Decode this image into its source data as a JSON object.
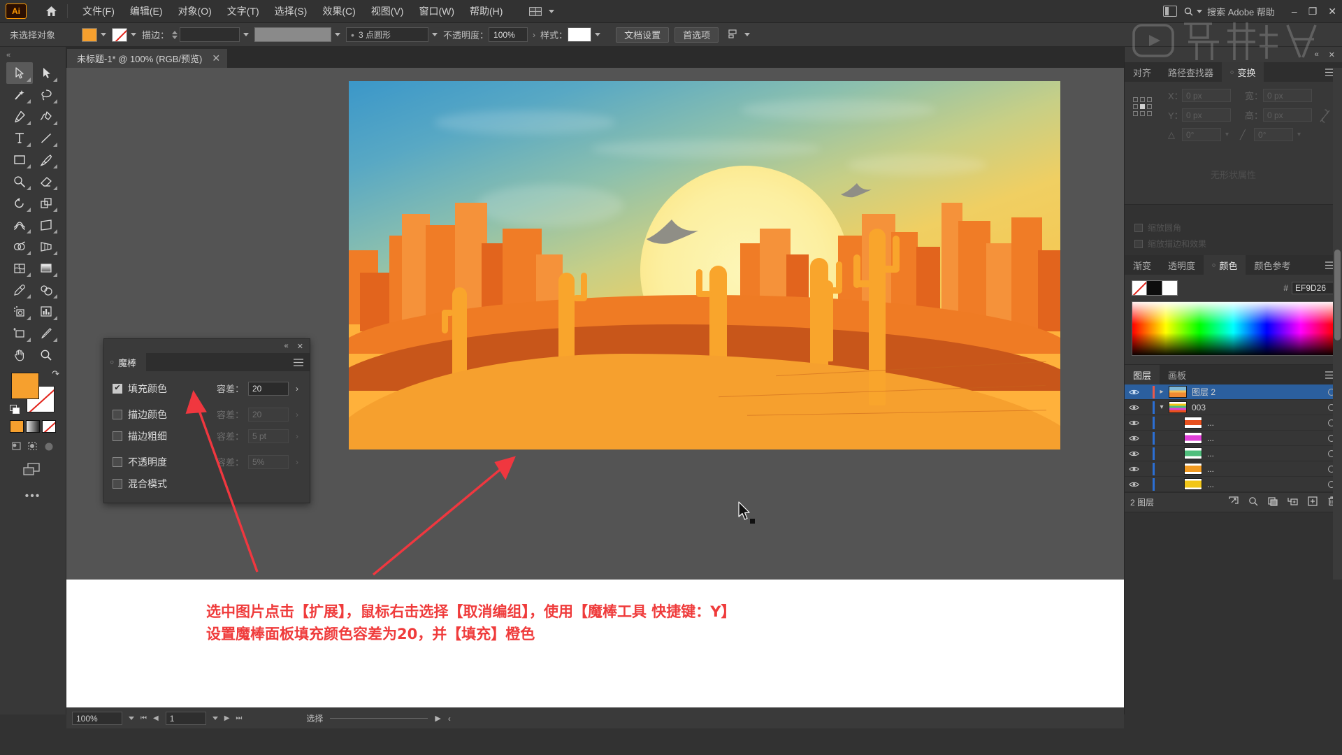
{
  "app": {
    "logo": "Ai",
    "home_icon": "home-icon",
    "search_placeholder": "搜索 Adobe 帮助",
    "window_minimize": "–",
    "window_maximize": "❐",
    "window_close": "✕"
  },
  "menu": {
    "items": [
      {
        "label": "文件(F)"
      },
      {
        "label": "编辑(E)"
      },
      {
        "label": "对象(O)"
      },
      {
        "label": "文字(T)"
      },
      {
        "label": "选择(S)"
      },
      {
        "label": "效果(C)"
      },
      {
        "label": "视图(V)"
      },
      {
        "label": "窗口(W)"
      },
      {
        "label": "帮助(H)"
      }
    ]
  },
  "control_bar": {
    "selection_status": "未选择对象",
    "fill_color": "#F6A02E",
    "stroke_label": "描边：",
    "stroke_weight": "",
    "stroke_profile": "",
    "brush_definition": "",
    "variable_width": "3 点圆形",
    "opacity_label": "不透明度：",
    "opacity_value": "100%",
    "style_label": "样式：",
    "doc_setup_button": "文档设置",
    "preferences_button": "首选项",
    "align_icon": "align-objects-icon"
  },
  "document_tab": {
    "title": "未标题-1* @ 100% (RGB/预览)",
    "close": "✕"
  },
  "toolbar": {
    "collapse": "«",
    "tools": [
      {
        "name": "selection-tool",
        "active": true
      },
      {
        "name": "direct-selection-tool",
        "active": false
      },
      {
        "name": "magic-wand-tool",
        "active": false
      },
      {
        "name": "lasso-tool",
        "active": false
      },
      {
        "name": "pen-tool",
        "active": false
      },
      {
        "name": "curvature-tool",
        "active": false
      },
      {
        "name": "type-tool",
        "active": false
      },
      {
        "name": "line-segment-tool",
        "active": false
      },
      {
        "name": "rectangle-tool",
        "active": false
      },
      {
        "name": "paintbrush-tool",
        "active": false
      },
      {
        "name": "shaper-tool",
        "active": false
      },
      {
        "name": "eraser-tool",
        "active": false
      },
      {
        "name": "rotate-tool",
        "active": false
      },
      {
        "name": "scale-tool",
        "active": false
      },
      {
        "name": "width-tool",
        "active": false
      },
      {
        "name": "free-transform-tool",
        "active": false
      },
      {
        "name": "shape-builder-tool",
        "active": false
      },
      {
        "name": "perspective-grid-tool",
        "active": false
      },
      {
        "name": "mesh-tool",
        "active": false
      },
      {
        "name": "gradient-tool",
        "active": false
      },
      {
        "name": "eyedropper-tool",
        "active": false
      },
      {
        "name": "blend-tool",
        "active": false
      },
      {
        "name": "symbol-sprayer-tool",
        "active": false
      },
      {
        "name": "column-graph-tool",
        "active": false
      },
      {
        "name": "artboard-tool",
        "active": false
      },
      {
        "name": "slice-tool",
        "active": false
      },
      {
        "name": "hand-tool",
        "active": false
      },
      {
        "name": "zoom-tool",
        "active": false
      }
    ],
    "fill_swatch": "#F6A02E",
    "stroke_swatch": "none",
    "more_tools": "•••"
  },
  "magic_wand_panel": {
    "title": "魔棒",
    "collapse_icon": "«",
    "close_icon": "✕",
    "menu_icon": "panel-menu-icon",
    "rows": [
      {
        "label": "填充颜色",
        "checked": true,
        "tol_label": "容差：",
        "tol_value": "20",
        "enabled": true
      },
      {
        "label": "描边颜色",
        "checked": false,
        "tol_label": "容差：",
        "tol_value": "20",
        "enabled": false
      },
      {
        "label": "描边粗细",
        "checked": false,
        "tol_label": "容差：",
        "tol_value": "5 pt",
        "enabled": false
      },
      {
        "label": "不透明度",
        "checked": false,
        "tol_label": "容差：",
        "tol_value": "5%",
        "enabled": false
      },
      {
        "label": "混合模式",
        "checked": false,
        "tol_label": "",
        "tol_value": "",
        "enabled": false
      }
    ]
  },
  "transform_panel": {
    "tabs": [
      {
        "label": "对齐",
        "active": false
      },
      {
        "label": "路径查找器",
        "active": false
      },
      {
        "label": "变换",
        "active": true
      }
    ],
    "x_label": "X：",
    "x_value": "0 px",
    "y_label": "Y：",
    "y_value": "0 px",
    "w_label": "宽：",
    "w_value": "0 px",
    "h_label": "高：",
    "h_value": "0 px",
    "angle_value": "0°",
    "shear_value": "0°",
    "link_icon": "link-broken-icon",
    "empty_note": "无形状属性",
    "scale_strokes_label": "缩放描边和效果",
    "scale_corners_label": "缩放圆角"
  },
  "color_panel": {
    "tabs": [
      {
        "label": "渐变",
        "active": false
      },
      {
        "label": "透明度",
        "active": false
      },
      {
        "label": "颜色",
        "active": true
      },
      {
        "label": "颜色参考",
        "active": false
      }
    ],
    "hex_hash": "#",
    "hex_value": "EF9D26",
    "swatch_none": "none-swatch",
    "swatch_black": "#0D0D0D",
    "swatch_white": "#FFFFFF"
  },
  "layers_panel": {
    "tabs": [
      {
        "label": "图层",
        "active": true
      },
      {
        "label": "画板",
        "active": false
      }
    ],
    "rows": [
      {
        "name": "图层 2",
        "selected": true,
        "indent": 0,
        "expanded": false,
        "color": "#E8594A",
        "thumb": "artwork-thumb",
        "eye": true
      },
      {
        "name": "003",
        "selected": false,
        "indent": 0,
        "expanded": true,
        "color": "#2B6FD4",
        "thumb": "group-thumb",
        "eye": true
      },
      {
        "name": "...",
        "selected": false,
        "indent": 1,
        "expanded": null,
        "color": "#2B6FD4",
        "thumb": "#E8511F",
        "eye": true
      },
      {
        "name": "...",
        "selected": false,
        "indent": 1,
        "expanded": null,
        "color": "#2B6FD4",
        "thumb": "#E040D8",
        "eye": true
      },
      {
        "name": "...",
        "selected": false,
        "indent": 1,
        "expanded": null,
        "color": "#2B6FD4",
        "thumb": "#4FBE7C",
        "eye": true
      },
      {
        "name": "...",
        "selected": false,
        "indent": 1,
        "expanded": null,
        "color": "#2B6FD4",
        "thumb": "#F29B22",
        "eye": true
      },
      {
        "name": "...",
        "selected": false,
        "indent": 1,
        "expanded": null,
        "color": "#2B6FD4",
        "thumb": "#F2C617",
        "eye": true
      }
    ],
    "footer_count": "2 图层",
    "footer_icons": [
      "locate-object-icon",
      "search-layer-icon",
      "make-clipping-mask-icon",
      "create-sublayer-icon",
      "create-layer-icon",
      "delete-layer-icon"
    ]
  },
  "status_bar": {
    "zoom": "100%",
    "page": "1",
    "status_text": "选择",
    "nav_first": "⏮",
    "nav_prev": "◀",
    "nav_next": "▶",
    "nav_last": "⏭"
  },
  "annotation": {
    "line1": "选中图片点击【扩展】，鼠标右击选择【取消编组】，使用【魔棒工具 快捷键：Y】",
    "line2": "设置魔棒面板填充颜色容差为20，并【填充】橙色",
    "color": "#EF3B3B"
  },
  "artwork": {
    "title": "desert-sunset-illustration",
    "sky_top": "#3B97C9",
    "sky_bottom": "#F7C44D",
    "sun_color": "#FCEFA0",
    "mesa_color": "#F07C26",
    "mesa_dark": "#E2641D",
    "dune_near": "#F6A02E",
    "dune_mid": "#C8561A",
    "cactus_color": "#F9A52C"
  }
}
